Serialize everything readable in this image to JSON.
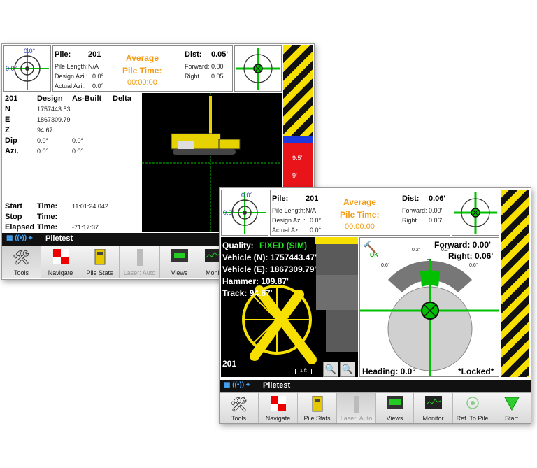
{
  "back": {
    "header": {
      "pile_label": "Pile:",
      "pile_value": "201",
      "pile_length_label": "Pile Length:",
      "pile_length_value": "N/A",
      "design_azi_label": "Design Azi.:",
      "design_azi_value": "0.0°",
      "actual_azi_label": "Actual Azi.:",
      "actual_azi_value": "0.0°",
      "avg_title": "Average",
      "avg_title2": "Pile Time:",
      "avg_value": "00:00:00",
      "dist_label": "Dist:",
      "dist_value": "0.05'",
      "forward_label": "Forward:",
      "forward_value": "0.00'",
      "right_label": "Right",
      "right_value": "0.05'",
      "level_top": "0.0°",
      "level_left": "0.0°"
    },
    "table": {
      "id": "201",
      "col_design": "Design",
      "col_asbuilt": "As-Built",
      "col_delta": "Delta",
      "rows": [
        {
          "label": "N",
          "design": "1757443.53",
          "asbuilt": ""
        },
        {
          "label": "E",
          "design": "1867309.79",
          "asbuilt": ""
        },
        {
          "label": "Z",
          "design": "94.67",
          "asbuilt": ""
        },
        {
          "label": "Dip",
          "design": "0.0°",
          "asbuilt": "0.0°"
        },
        {
          "label": "Azi.",
          "design": "0.0°",
          "asbuilt": "0.0°"
        }
      ],
      "times": [
        {
          "label": "Start",
          "tlabel": "Time:",
          "value": "11:01:24.042"
        },
        {
          "label": "Stop",
          "tlabel": "Time:",
          "value": ""
        },
        {
          "label": "Elapsed",
          "tlabel": "Time:",
          "value": "-71:17:37"
        }
      ]
    },
    "scale": [
      "9.5'",
      "9'"
    ],
    "status": "Piletest",
    "toolbar": [
      "Tools",
      "Navigate",
      "Pile Stats",
      "Laser: Auto",
      "Views",
      "Monit"
    ]
  },
  "front": {
    "header": {
      "pile_label": "Pile:",
      "pile_value": "201",
      "pile_length_label": "Pile Length:",
      "pile_length_value": "N/A",
      "design_azi_label": "Design Azi.:",
      "design_azi_value": "0.0°",
      "actual_azi_label": "Actual Azi.:",
      "actual_azi_value": "0.0°",
      "avg_title": "Average",
      "avg_title2": "Pile Time:",
      "avg_value": "00:00:00",
      "dist_label": "Dist:",
      "dist_value": "0.06'",
      "forward_label": "Forward:",
      "forward_value": "0.00'",
      "right_label": "Right",
      "right_value": "0.06'",
      "level_top": "0.0°",
      "level_left": "0.0°"
    },
    "map": {
      "quality_label": "Quality:",
      "quality_value": "FIXED (SIM)",
      "vehicle_n": "Vehicle (N): 1757443.47'",
      "vehicle_e": "Vehicle (E): 1867309.79'",
      "hammer": "Hammer: 109.87'",
      "track": "Track: 94.67'",
      "pile_id": "201",
      "scale": "1 ft"
    },
    "target": {
      "ok": "OK",
      "forward": "Forward: 0.00'",
      "right": "Right: 0.06'",
      "heading": "Heading: 0.0°",
      "locked": "*Locked*",
      "deg_02a": "0.2°",
      "deg_02b": "0.2°",
      "deg_06a": "0.6°",
      "deg_06b": "0.6°",
      "deg_0": "0°"
    },
    "status": "Piletest",
    "toolbar": [
      "Tools",
      "Navigate",
      "Pile Stats",
      "Laser: Auto",
      "Views",
      "Monitor",
      "Ref. To Pile",
      "Start"
    ]
  },
  "colors": {
    "accent_green": "#00c000",
    "hazard_yellow": "#f7e000",
    "avg_orange": "#f39c12",
    "quality_green": "#22dd22"
  }
}
